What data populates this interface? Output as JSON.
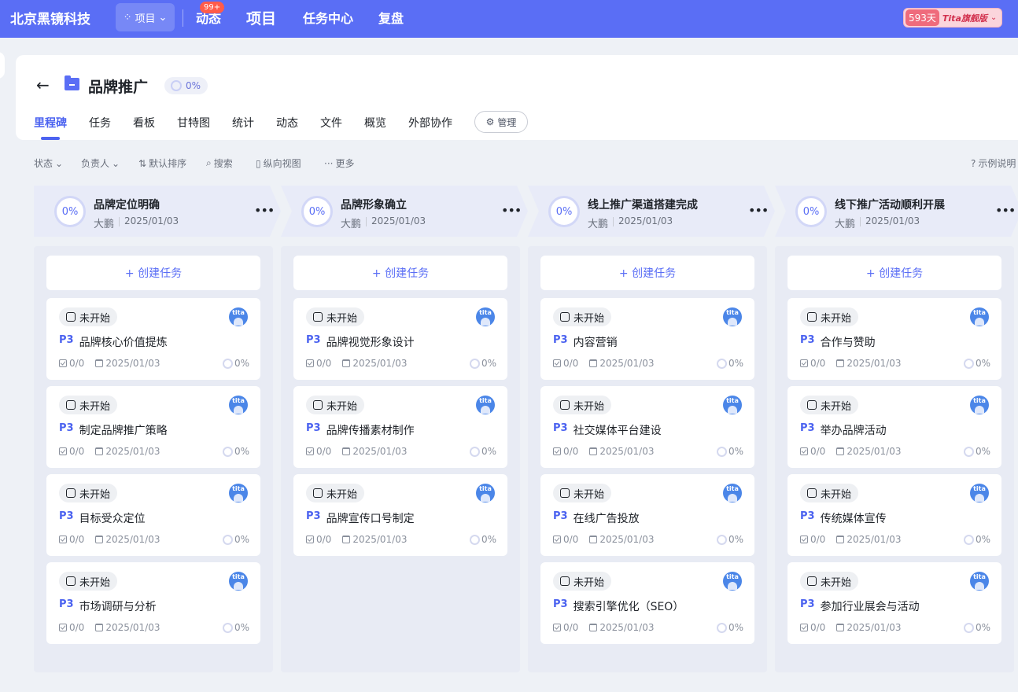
{
  "topbar": {
    "company": "北京黑镜科技",
    "project_switch": "项目",
    "nav": [
      {
        "label": "动态",
        "badge": "99+"
      },
      {
        "label": "项目"
      },
      {
        "label": "任务中心"
      },
      {
        "label": "复盘"
      }
    ],
    "tita_days": "593天",
    "tita_edition": "Tita旗舰版"
  },
  "project": {
    "title": "品牌推广",
    "progress": "0%",
    "tabs": [
      "里程碑",
      "任务",
      "看板",
      "甘特图",
      "统计",
      "动态",
      "文件",
      "概览",
      "外部协作"
    ],
    "active_tab": "里程碑",
    "manage_label": "管理"
  },
  "toolbar": {
    "status": "状态",
    "owner": "负责人",
    "sort": "默认排序",
    "search": "搜索",
    "view": "纵向视图",
    "more": "更多",
    "legend": "示例说明"
  },
  "create_label": "+ 创建任务",
  "milestones": [
    {
      "title": "品牌定位明确",
      "progress": "0%",
      "owner": "大鹏",
      "date": "2025/01/03",
      "tasks": [
        {
          "status": "未开始",
          "priority": "P3",
          "title": "品牌核心价值提炼",
          "subtasks": "0/0",
          "date": "2025/01/03",
          "progress": "0%"
        },
        {
          "status": "未开始",
          "priority": "P3",
          "title": "制定品牌推广策略",
          "subtasks": "0/0",
          "date": "2025/01/03",
          "progress": "0%"
        },
        {
          "status": "未开始",
          "priority": "P3",
          "title": "目标受众定位",
          "subtasks": "0/0",
          "date": "2025/01/03",
          "progress": "0%"
        },
        {
          "status": "未开始",
          "priority": "P3",
          "title": "市场调研与分析",
          "subtasks": "0/0",
          "date": "2025/01/03",
          "progress": "0%"
        }
      ]
    },
    {
      "title": "品牌形象确立",
      "progress": "0%",
      "owner": "大鹏",
      "date": "2025/01/03",
      "tasks": [
        {
          "status": "未开始",
          "priority": "P3",
          "title": "品牌视觉形象设计",
          "subtasks": "0/0",
          "date": "2025/01/03",
          "progress": "0%"
        },
        {
          "status": "未开始",
          "priority": "P3",
          "title": "品牌传播素材制作",
          "subtasks": "0/0",
          "date": "2025/01/03",
          "progress": "0%"
        },
        {
          "status": "未开始",
          "priority": "P3",
          "title": "品牌宣传口号制定",
          "subtasks": "0/0",
          "date": "2025/01/03",
          "progress": "0%"
        }
      ]
    },
    {
      "title": "线上推广渠道搭建完成",
      "progress": "0%",
      "owner": "大鹏",
      "date": "2025/01/03",
      "tasks": [
        {
          "status": "未开始",
          "priority": "P3",
          "title": "内容营销",
          "subtasks": "0/0",
          "date": "2025/01/03",
          "progress": "0%"
        },
        {
          "status": "未开始",
          "priority": "P3",
          "title": "社交媒体平台建设",
          "subtasks": "0/0",
          "date": "2025/01/03",
          "progress": "0%"
        },
        {
          "status": "未开始",
          "priority": "P3",
          "title": "在线广告投放",
          "subtasks": "0/0",
          "date": "2025/01/03",
          "progress": "0%"
        },
        {
          "status": "未开始",
          "priority": "P3",
          "title": "搜索引擎优化（SEO）",
          "subtasks": "0/0",
          "date": "2025/01/03",
          "progress": "0%"
        }
      ]
    },
    {
      "title": "线下推广活动顺利开展",
      "progress": "0%",
      "owner": "大鹏",
      "date": "2025/01/03",
      "tasks": [
        {
          "status": "未开始",
          "priority": "P3",
          "title": "合作与赞助",
          "subtasks": "0/0",
          "date": "2025/01/03",
          "progress": "0%"
        },
        {
          "status": "未开始",
          "priority": "P3",
          "title": "举办品牌活动",
          "subtasks": "0/0",
          "date": "2025/01/03",
          "progress": "0%"
        },
        {
          "status": "未开始",
          "priority": "P3",
          "title": "传统媒体宣传",
          "subtasks": "0/0",
          "date": "2025/01/03",
          "progress": "0%"
        },
        {
          "status": "未开始",
          "priority": "P3",
          "title": "参加行业展会与活动",
          "subtasks": "0/0",
          "date": "2025/01/03",
          "progress": "0%"
        }
      ]
    }
  ],
  "avatar_text": "tita"
}
